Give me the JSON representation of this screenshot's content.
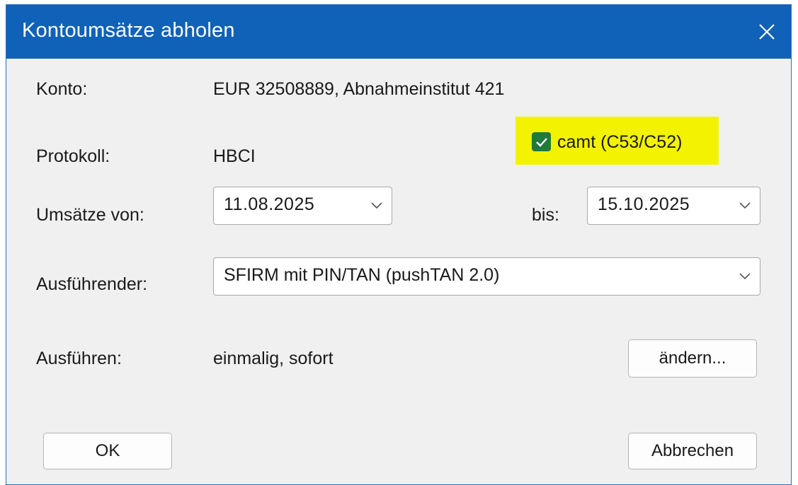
{
  "window": {
    "title": "Kontoumsätze abholen"
  },
  "konto": {
    "label": "Konto:",
    "value": "EUR 32508889, Abnahmeinstitut 421"
  },
  "protokoll": {
    "label": "Protokoll:",
    "value": "HBCI"
  },
  "camt_checkbox": {
    "label": "camt (C53/C52)",
    "checked": true,
    "highlight_color": "#f3f200",
    "check_color": "#1f7a3c"
  },
  "umsaetze": {
    "from_label": "Umsätze von:",
    "from_value": "11.08.2025",
    "to_label": "bis:",
    "to_value": "15.10.2025"
  },
  "ausfuehrender": {
    "label": "Ausführender:",
    "value": "SFIRM mit PIN/TAN (pushTAN 2.0)"
  },
  "ausfuehren": {
    "label": "Ausführen:",
    "value": "einmalig, sofort",
    "change_button": "ändern..."
  },
  "buttons": {
    "ok": "OK",
    "cancel": "Abbrechen"
  },
  "colors": {
    "titlebar": "#0f62b8",
    "dialog_bg": "#f0f0f0"
  },
  "icons": {
    "close": "close-icon",
    "dropdown": "chevron-down-icon",
    "check": "checkmark-icon"
  }
}
